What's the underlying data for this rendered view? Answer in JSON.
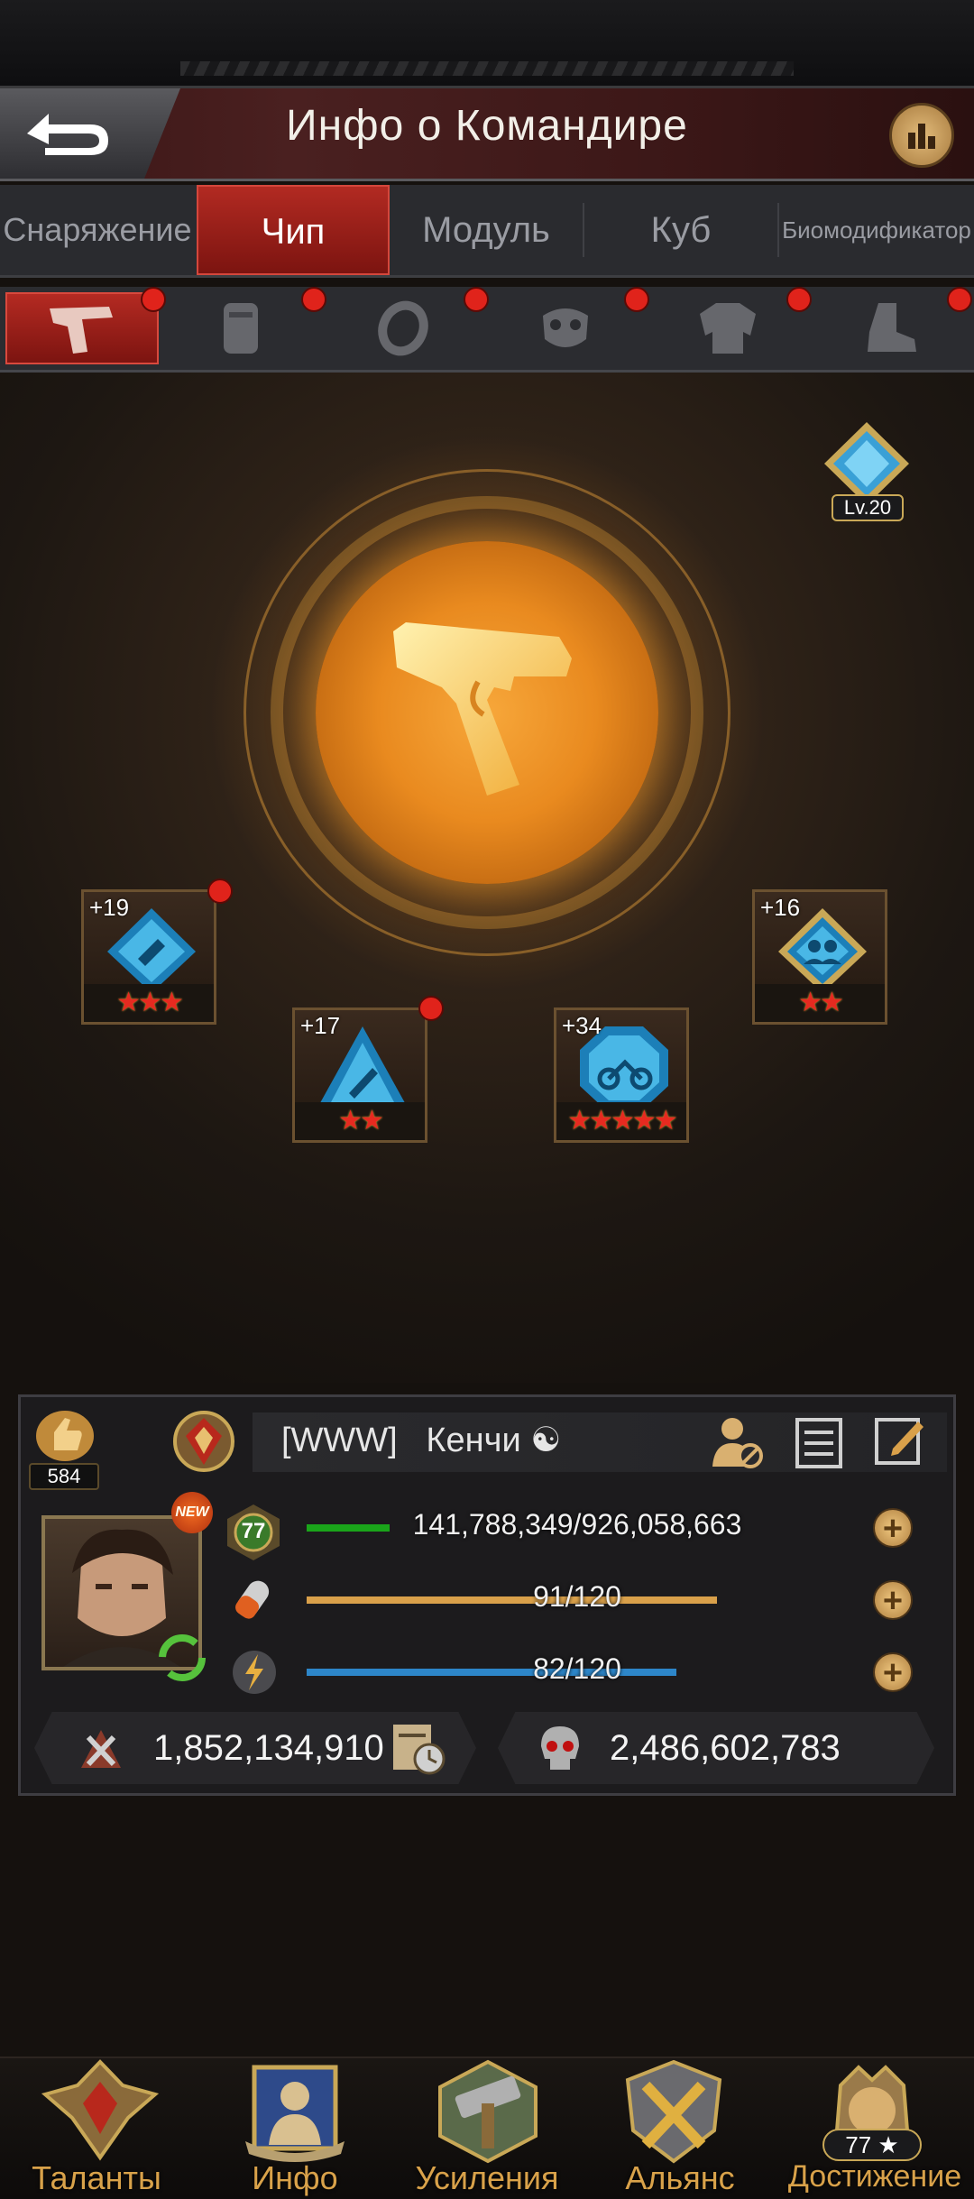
{
  "header": {
    "title": "Инфо о Командире"
  },
  "category_tabs": [
    "Снаряжение",
    "Чип",
    "Модуль",
    "Куб",
    "Биомодификатор"
  ],
  "active_category": "Чип",
  "equipment_slots": [
    "pistol-icon",
    "vest-icon",
    "ring-icon",
    "gas-mask-icon",
    "jacket-icon",
    "boot-icon"
  ],
  "core": {
    "level": "Lv.20",
    "center_icon": "pistol-icon"
  },
  "chips": [
    {
      "level": "+19",
      "stars": "★★★",
      "shape": "diamond"
    },
    {
      "level": "+17",
      "stars": "★★",
      "shape": "triangle"
    },
    {
      "level": "+34",
      "stars": "★★★★★",
      "shape": "octagon"
    },
    {
      "level": "+16",
      "stars": "★★",
      "shape": "diamond"
    }
  ],
  "commander": {
    "power_level": "584",
    "name": "[WWW]   Кенчи ☯",
    "new_badge": "NEW",
    "level": "77",
    "experience": {
      "text": "141,788,349/926,058,663",
      "fraction": 0.153
    },
    "stamina": {
      "text": "91/120",
      "fraction": 0.758
    },
    "energy": {
      "text": "82/120",
      "fraction": 0.683
    },
    "power": "1,852,134,910",
    "kills": "2,486,602,783"
  },
  "bottom_nav": [
    {
      "label": "Таланты",
      "icon": "talents-icon"
    },
    {
      "label": "Инфо",
      "icon": "info-icon"
    },
    {
      "label": "Усиления",
      "icon": "boosts-icon"
    },
    {
      "label": "Альянс",
      "icon": "alliance-icon"
    },
    {
      "label": "Достижение",
      "icon": "achievement-icon",
      "badge": "77 ★"
    }
  ],
  "colors": {
    "accent_red": "#b22a22",
    "gold": "#d9a24a",
    "exp_bar": "#1aa51a",
    "stamina_bar": "#d9a04a",
    "energy_bar": "#2d86c9"
  }
}
